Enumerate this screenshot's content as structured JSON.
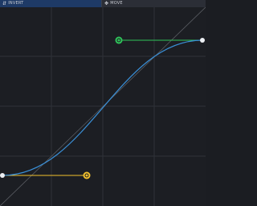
{
  "toolbar": {
    "invert": {
      "label": "INVERT",
      "icon": "swap-vertical-icon"
    },
    "move": {
      "label": "MOVE",
      "icon": "move-arrows-icon"
    }
  },
  "colors": {
    "background": "#1c1e23",
    "grid": "#2f3238",
    "curve": "#3a8fd6",
    "diagonal": "#5a5d63",
    "handle_start": "#f2c12e",
    "handle_end": "#2fc45a",
    "active_tab": "#1e3a66"
  },
  "curve": {
    "type": "cubic-bezier",
    "p0": [
      0,
      0
    ],
    "p1": [
      0.42,
      0
    ],
    "p2": [
      0.58,
      1
    ],
    "p3": [
      1,
      1
    ]
  }
}
